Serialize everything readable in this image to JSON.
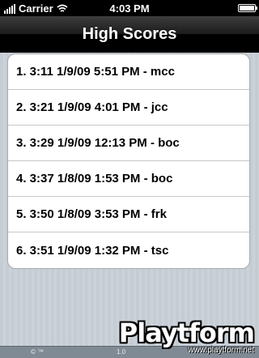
{
  "status": {
    "carrier": "Carrier",
    "time": "4:03 PM"
  },
  "nav": {
    "title": "High Scores"
  },
  "scores": [
    "1. 3:11 1/9/09 5:51 PM - mcc",
    "2. 3:21 1/9/09 4:01 PM - jcc",
    "3. 3:29 1/9/09 12:13 PM - boc",
    "4. 3:37 1/8/09 1:53 PM - boc",
    "5. 3:50 1/8/09 3:53 PM - frk",
    "6. 3:51 1/9/09 1:32 PM - tsc"
  ],
  "footer": {
    "left": "© ™",
    "mid": "1.0"
  },
  "watermark": {
    "logo": "Playtform",
    "url": "www.playtform.net"
  },
  "colors": {
    "background": "#c5ccd4",
    "nav_bar": "#000000",
    "row_text": "#000000"
  }
}
